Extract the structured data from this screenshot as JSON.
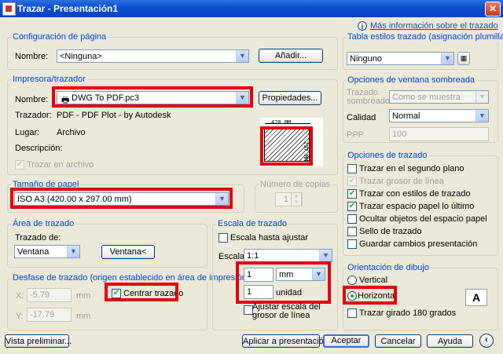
{
  "window": {
    "title": "Trazar - Presentación1",
    "close": "✕"
  },
  "info_link": "Más información sobre el trazado",
  "page_setup": {
    "title": "Configuración de página",
    "name_label": "Nombre:",
    "value": "<Ninguna>",
    "add_button": "Añadir..."
  },
  "plotter": {
    "title": "Impresora/trazador",
    "name_label": "Nombre:",
    "value": "DWG To PDF.pc3",
    "properties_button": "Propiedades...",
    "plotter_label": "Trazador:",
    "plotter_value": "PDF - PDF Plot - by Autodesk",
    "where_label": "Lugar:",
    "where_value": "Archivo",
    "description_label": "Descripción:",
    "plot_to_file": "Trazar en archivo",
    "preview_width": "420 MM",
    "preview_height": "297 MM"
  },
  "paper_size": {
    "title": "Tamaño de papel",
    "value": "ISO A3 (420.00 x 297.00 mm)"
  },
  "copies": {
    "title": "Número de copias",
    "value": "1"
  },
  "plot_area": {
    "title": "Área de trazado",
    "what_label": "Trazado de:",
    "value": "Ventana",
    "window_button": "Ventana<"
  },
  "plot_scale": {
    "title": "Escala de trazado",
    "fit": "Escala hasta ajustar",
    "scale_label": "Escala:",
    "scale_value": "1:1",
    "units_value": "1",
    "units_select": "mm",
    "unit_value": "1",
    "unit_label": "unidad",
    "scale_lineweights": "Ajustar escala del grosor de línea"
  },
  "plot_offset": {
    "title": "Desfase de trazado (origen establecido en área de impresión)",
    "x_label": "X:",
    "x_value": "-5.79",
    "x_unit": "mm",
    "y_label": "Y:",
    "y_value": "-17.79",
    "y_unit": "mm",
    "center": "Centrar trazado"
  },
  "style_table": {
    "title": "Tabla estilos trazado (asignación plumillas)",
    "value": "Ninguno"
  },
  "shaded": {
    "title": "Opciones de ventana sombreada",
    "shade_label": "Trazado sombreado",
    "shade_value": "Como se muestra",
    "quality_label": "Calidad",
    "quality_value": "Normal",
    "dpi_label": "PPP",
    "dpi_value": "100"
  },
  "plot_options": {
    "title": "Opciones de trazado",
    "items": [
      {
        "label": "Trazar en el segundo plano",
        "checked": false,
        "disabled": false
      },
      {
        "label": "Trazar grosor de línea",
        "checked": true,
        "disabled": true
      },
      {
        "label": "Trazar con estilos de trazado",
        "checked": true,
        "disabled": false
      },
      {
        "label": "Trazar espacio papel lo último",
        "checked": true,
        "disabled": false
      },
      {
        "label": "Ocultar objetos del espacio papel",
        "checked": false,
        "disabled": false
      },
      {
        "label": "Sello de trazado",
        "checked": false,
        "disabled": false
      },
      {
        "label": "Guardar cambios presentación",
        "checked": false,
        "disabled": false
      }
    ]
  },
  "orientation": {
    "title": "Orientación de dibujo",
    "vertical": "Vertical",
    "horizontal": "Horizontal",
    "upside_down": "Trazar girado 180 grados",
    "preview_letter": "A"
  },
  "buttons": {
    "preview": "Vista preliminar...",
    "apply": "Aplicar a presentación",
    "ok": "Aceptar",
    "cancel": "Cancelar",
    "help": "Ayuda",
    "collapse": "‹"
  }
}
